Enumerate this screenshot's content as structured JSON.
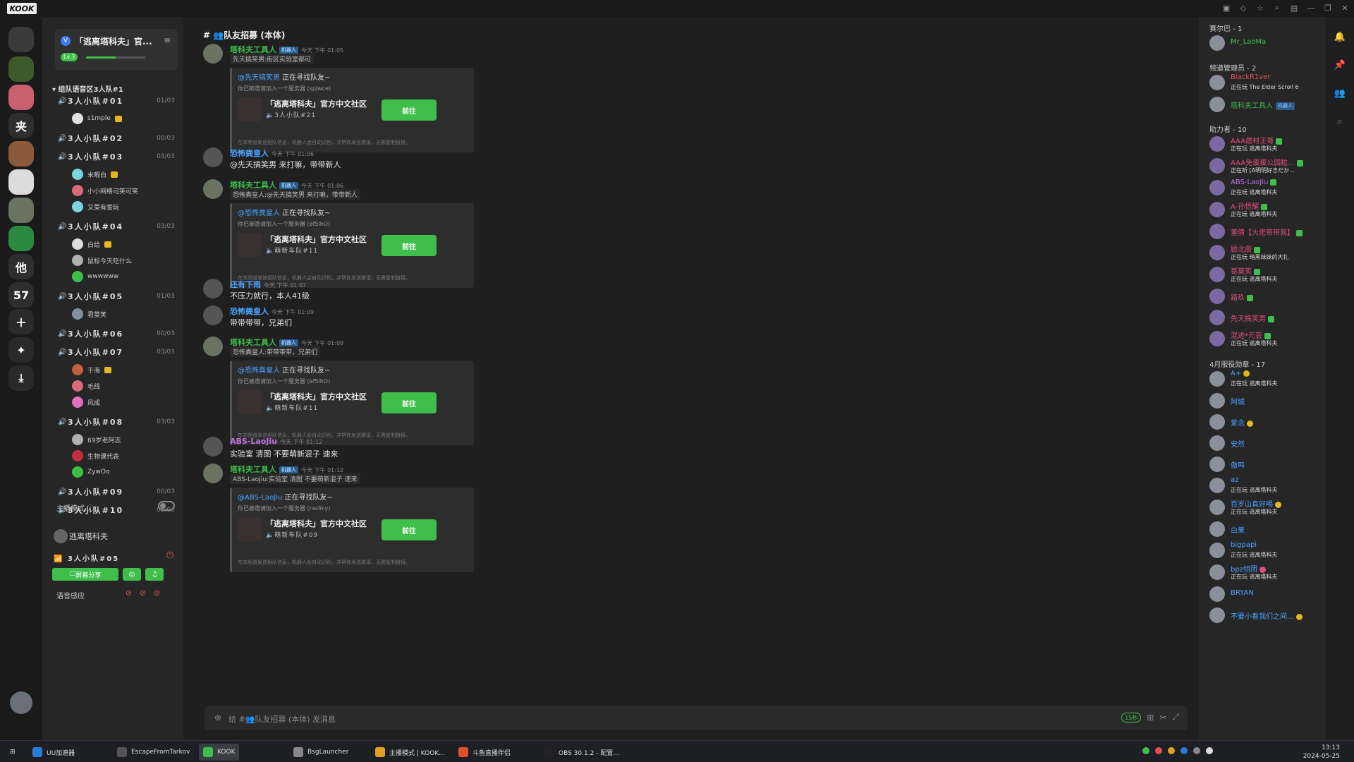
{
  "window": {
    "logo": "KOOK"
  },
  "rail": {
    "servers": [
      {
        "label": "",
        "color": "#3a3a3a",
        "icon": "chat-bubble-icon"
      },
      {
        "label": "",
        "color": "#3d5a2d"
      },
      {
        "label": "",
        "color": "#c86070"
      },
      {
        "label": "夹",
        "color": "#2e2e2e"
      },
      {
        "label": "",
        "color": "#8a5a3a"
      },
      {
        "label": "",
        "color": "#dcdcdc"
      },
      {
        "label": "",
        "color": "#6a7260"
      },
      {
        "label": "",
        "color": "#2a8a40"
      },
      {
        "label": "他",
        "color": "#2e2e2e"
      },
      {
        "label": "57",
        "color": "#2e2e2e"
      }
    ]
  },
  "guild": {
    "name": "「逃离塔科夫」官...",
    "level": "Lv.3",
    "level_progress": 0.5
  },
  "category": "▾ 组队语音区3人队#1",
  "channels": [
    {
      "name": "3人小队#01",
      "count": "01/03",
      "members": [
        {
          "name": "s1mple",
          "vip": true,
          "color": "#e2e2e2"
        }
      ]
    },
    {
      "name": "3人小队#02",
      "count": "00/03",
      "members": []
    },
    {
      "name": "3人小队#03",
      "count": "03/03",
      "members": [
        {
          "name": "末暇白",
          "vip": true,
          "color": "#7dd3e0"
        },
        {
          "name": "小小网络可笑可笑",
          "vip": false,
          "color": "#d86a7a"
        },
        {
          "name": "又菜有爱玩",
          "vip": false,
          "color": "#7dd3e0"
        }
      ]
    },
    {
      "name": "3人小队#04",
      "count": "03/03",
      "members": [
        {
          "name": "白给",
          "vip": true,
          "color": "#dcdcdc"
        },
        {
          "name": "鼠标今天吃什么",
          "vip": false,
          "color": "#b0b0b0"
        },
        {
          "name": "wwwwww",
          "vip": false,
          "color": "#3fbf4a"
        }
      ]
    },
    {
      "name": "3人小队#05",
      "count": "01/03",
      "members": [
        {
          "name": "君莫笑",
          "vip": false,
          "color": "#8090a0"
        }
      ]
    },
    {
      "name": "3人小队#06",
      "count": "00/03",
      "members": []
    },
    {
      "name": "3人小队#07",
      "count": "03/03",
      "members": [
        {
          "name": "于海",
          "vip": true,
          "color": "#c06040"
        },
        {
          "name": "毛线",
          "vip": false,
          "color": "#d86a7a"
        },
        {
          "name": "风成",
          "vip": false,
          "color": "#e070c0"
        }
      ]
    },
    {
      "name": "3人小队#08",
      "count": "03/03",
      "members": [
        {
          "name": "69岁老阿志",
          "vip": false,
          "color": "#b0b0b0"
        },
        {
          "name": "生物课代表",
          "vip": false,
          "color": "#c03040"
        },
        {
          "name": "ZywOo",
          "vip": false,
          "color": "#3fbf4a"
        }
      ]
    },
    {
      "name": "3人小队#09",
      "count": "00/03",
      "members": []
    },
    {
      "name": "3人小队#10",
      "count": "00/03",
      "members": []
    }
  ],
  "host_mode": {
    "label": "主播模式 ⓘ"
  },
  "voice_panel": {
    "server": "逃离塔科夫",
    "channel": "3人小队#05",
    "share": "屏幕分享",
    "sensitivity": "语音感应"
  },
  "chat": {
    "title": "#  👥队友招募 (本体)",
    "input_placeholder": "给 #👥队友招募 (本体) 发消息",
    "timer": "15秒",
    "messages": [
      {
        "user": "塔科夫工具人",
        "bot": true,
        "ts": "今天 下午 01:05",
        "color": "#3fbf4a",
        "quote": "先天搞笑男:街区实验室都可",
        "card": {
          "at": "@先天搞笑男",
          "head": " 正在寻找队友~",
          "inv": "你已被邀请加入一个服务器 (spjwce)",
          "server": "「逃离塔科夫」官方中文社区",
          "sub": "🔈3人小队#21",
          "btn": "前往",
          "note": "在本频道发送组队信息，机器人会自动识别，并帮你发送邀请，无需复制链接。"
        }
      },
      {
        "user": "恐怖粪皇人",
        "bot": false,
        "ts": "今天 下午 01:06",
        "color": "#4aa3ff",
        "text": "@先天搞笑男 来打嘛，带带新人"
      },
      {
        "user": "塔科夫工具人",
        "bot": true,
        "ts": "今天 下午 01:06",
        "color": "#3fbf4a",
        "quote": "恐怖粪皇人:@先天搞笑男 来打嘛，带带新人",
        "card": {
          "at": "@恐怖粪皇人",
          "head": " 正在寻找队友~",
          "inv": "你已被邀请加入一个服务器 (ef5lhO)",
          "server": "「逃离塔科夫」官方中文社区",
          "sub": "🔈萌新车队#11",
          "btn": "前往",
          "note": "在本频道发送组队信息，机器人会自动识别，并帮你发送邀请，无需复制链接。"
        }
      },
      {
        "user": "还有下雨",
        "bot": false,
        "ts": "今天 下午 01:07",
        "color": "#4aa3ff",
        "text": "不压力就行，本人41级"
      },
      {
        "user": "恐怖粪皇人",
        "bot": false,
        "ts": "今天 下午 01:09",
        "color": "#4aa3ff",
        "text": "带带带带，兄弟们"
      },
      {
        "user": "塔科夫工具人",
        "bot": true,
        "ts": "今天 下午 01:09",
        "color": "#3fbf4a",
        "quote": "恐怖粪皇人:带带带带，兄弟们",
        "card": {
          "at": "@恐怖粪皇人",
          "head": " 正在寻找队友~",
          "inv": "你已被邀请加入一个服务器 (ef5lhO)",
          "server": "「逃离塔科夫」官方中文社区",
          "sub": "🔈萌新车队#11",
          "btn": "前往",
          "note": "在本频道发送组队信息，机器人会自动识别，并帮你发送邀请，无需复制链接。"
        }
      },
      {
        "user": "ABS-LaoJiu",
        "bot": false,
        "ts": "今天 下午 01:12",
        "color": "#c070e0",
        "text": "实验室 清图 不要萌新混子 速来"
      },
      {
        "user": "塔科夫工具人",
        "bot": true,
        "ts": "今天 下午 01:12",
        "color": "#3fbf4a",
        "quote": "ABS-LaoJiu:实验室 清图 不要萌新混子 速来",
        "card": {
          "at": "@ABS-LaoJiu",
          "head": " 正在寻找队友~",
          "inv": "你已被邀请加入一个服务器 (ras9cy)",
          "server": "「逃离塔科夫」官方中文社区",
          "sub": "🔈萌新车队#09",
          "btn": "前往",
          "note": "在本频道发送组队信息，机器人会自动识别，并帮你发送邀请，无需复制链接。"
        }
      }
    ]
  },
  "members": {
    "groups": [
      {
        "title": "赛尔巴 - 1",
        "items": [
          {
            "name": "Mr_LaoMa",
            "status": "",
            "color": "#3fbf4a",
            "badge": ""
          }
        ]
      },
      {
        "title": "频道管理员 - 2",
        "items": [
          {
            "name": "BlackR1ver",
            "status": "正在玩 The Elder Scroll 6",
            "color": "#e25050",
            "badge": ""
          },
          {
            "name": "塔科夫工具人",
            "status": "",
            "color": "#3fbf4a",
            "badge": "机器人"
          }
        ]
      },
      {
        "title": "助力者 - 10",
        "items": [
          {
            "name": "AAA建材王哥",
            "status": "正在玩 逃离塔科夫",
            "color": "#e0507a",
            "badge": "g"
          },
          {
            "name": "AAA免蛋蛋公园粒...",
            "status": "正在听 [A明明好きだか...",
            "color": "#e0507a",
            "badge": "g"
          },
          {
            "name": "ABS-LaoJiu",
            "status": "正在玩 逃离塔科夫",
            "color": "#c070e0",
            "badge": "g"
          },
          {
            "name": "A-孙悟耀",
            "status": "正在玩 逃离塔科夫",
            "color": "#e0507a",
            "badge": "g"
          },
          {
            "name": "董倩【大佬带带我】",
            "status": "",
            "color": "#e0507a",
            "badge": "g"
          },
          {
            "name": "顾北辰",
            "status": "正在玩 暗黑妹妹的大扎",
            "color": "#e0507a",
            "badge": "g"
          },
          {
            "name": "哥莫笑",
            "status": "正在玩 逃离塔科夫",
            "color": "#e0507a",
            "badge": "g"
          },
          {
            "name": "路玖",
            "status": "",
            "color": "#e0507a",
            "badge": "g"
          },
          {
            "name": "先天搞笑男",
            "status": "",
            "color": "#e0507a",
            "badge": "g"
          },
          {
            "name": "混迹*元芸",
            "status": "正在玩 逃离塔科夫",
            "color": "#e0507a",
            "badge": "g"
          }
        ]
      },
      {
        "title": "4月服役勋章 - 17",
        "items": [
          {
            "name": "A+",
            "status": "正在玩 逃离塔科夫",
            "color": "#4aa3ff",
            "badge": "y"
          },
          {
            "name": "阿城",
            "status": "",
            "color": "#4aa3ff",
            "badge": ""
          },
          {
            "name": "爱念",
            "status": "",
            "color": "#4aa3ff",
            "badge": "y"
          },
          {
            "name": "安然",
            "status": "",
            "color": "#4aa3ff",
            "badge": ""
          },
          {
            "name": "傲鸣",
            "status": "",
            "color": "#4aa3ff",
            "badge": ""
          },
          {
            "name": "az",
            "status": "正在玩 逃离塔科夫",
            "color": "#4aa3ff",
            "badge": ""
          },
          {
            "name": "百岁山真好喝",
            "status": "正在玩 逃离塔科夫",
            "color": "#4aa3ff",
            "badge": "y"
          },
          {
            "name": "白果",
            "status": "",
            "color": "#4aa3ff",
            "badge": ""
          },
          {
            "name": "bigpapi",
            "status": "正在玩 逃离塔科夫",
            "color": "#4aa3ff",
            "badge": ""
          },
          {
            "name": "bpz组团",
            "status": "正在玩 逃离塔科夫",
            "color": "#4aa3ff",
            "badge": "p"
          },
          {
            "name": "BRYAN",
            "status": "",
            "color": "#4aa3ff",
            "badge": ""
          },
          {
            "name": "不要小看我们之间...",
            "status": "",
            "color": "#4aa3ff",
            "badge": "y"
          }
        ]
      }
    ]
  },
  "taskbar": {
    "items": [
      {
        "label": "UU加速器",
        "color": "#2a7ad8"
      },
      {
        "label": "EscapeFromTarkov",
        "color": "#555"
      },
      {
        "label": "KOOK",
        "color": "#3fbf4a"
      },
      {
        "label": "BsgLauncher",
        "color": "#888"
      },
      {
        "label": "主播模式 | KOOK...",
        "color": "#e0a020"
      },
      {
        "label": "斗鱼直播伴侣",
        "color": "#e05030"
      },
      {
        "label": "OBS 30.1.2 - 配置...",
        "color": "#222"
      }
    ],
    "time": "13:13",
    "date": "2024-05-25"
  }
}
